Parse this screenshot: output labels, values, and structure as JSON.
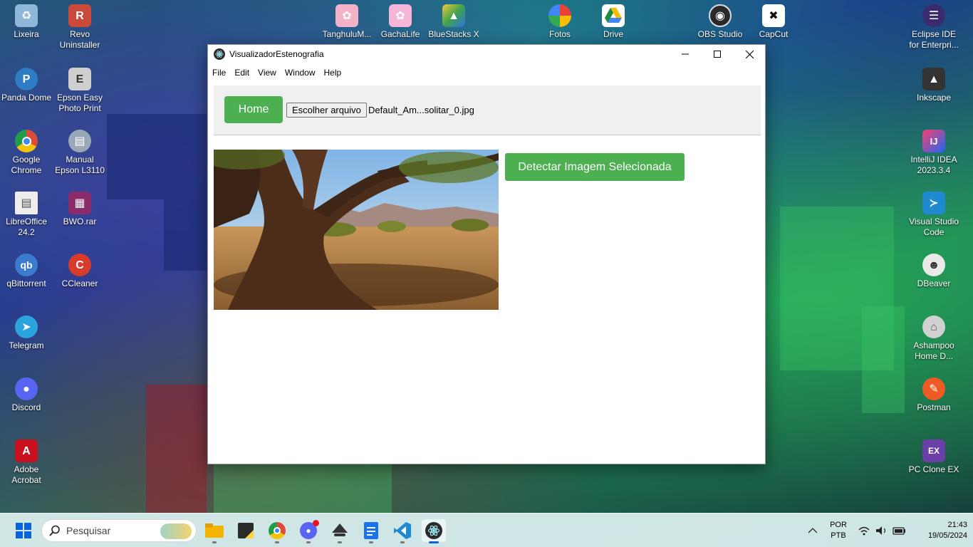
{
  "desktop": {
    "icons_left": [
      {
        "label": "Lixeira",
        "icon": "recycle-bin-icon",
        "color": "#8fb7d9"
      },
      {
        "label": "Revo Uninstaller",
        "icon": "revo-uninstaller-icon",
        "color": "#c94a3a"
      },
      {
        "label": "Panda Dome",
        "icon": "panda-dome-icon",
        "color": "#2e7cc4"
      },
      {
        "label": "Epson Easy Photo Print",
        "icon": "epson-photo-icon",
        "color": "#cfcfcf"
      },
      {
        "label": "Google Chrome",
        "icon": "chrome-icon",
        "color": "#dd4b39"
      },
      {
        "label": "Manual Epson L3110",
        "icon": "manual-icon",
        "color": "#9aa7b6"
      },
      {
        "label": "LibreOffice 24.2",
        "icon": "libreoffice-icon",
        "color": "#eeeeee"
      },
      {
        "label": "BWO.rar",
        "icon": "winrar-icon",
        "color": "#8a2b6a"
      },
      {
        "label": "qBittorrent",
        "icon": "qbittorrent-icon",
        "color": "#3b7cd1"
      },
      {
        "label": "CCleaner",
        "icon": "ccleaner-icon",
        "color": "#d83a2b"
      },
      {
        "label": "Telegram",
        "icon": "telegram-icon",
        "color": "#2aa3df"
      },
      {
        "label": "Discord",
        "icon": "discord-icon",
        "color": "#5865f2"
      },
      {
        "label": "Adobe Acrobat",
        "icon": "acrobat-icon",
        "color": "#c8101e"
      }
    ],
    "icons_top": [
      {
        "label": "TanghuluM...",
        "icon": "tanghulu-icon",
        "color": "#f3b2c8"
      },
      {
        "label": "GachaLife",
        "icon": "gachalife-icon",
        "color": "#f5b6d8"
      },
      {
        "label": "BlueStacks X",
        "icon": "bluestacks-icon",
        "color": "#3fa34d"
      },
      {
        "label": "Fotos",
        "icon": "photos-icon",
        "color": "#ffffff"
      },
      {
        "label": "Drive",
        "icon": "google-drive-icon",
        "color": "#ffffff"
      },
      {
        "label": "OBS Studio",
        "icon": "obs-icon",
        "color": "#2a2a2a"
      },
      {
        "label": "CapCut",
        "icon": "capcut-icon",
        "color": "#111111"
      }
    ],
    "icons_right": [
      {
        "label": "Eclipse IDE for Enterpri...",
        "icon": "eclipse-icon",
        "color": "#3a2a6e"
      },
      {
        "label": "Inkscape",
        "icon": "inkscape-icon",
        "color": "#333333"
      },
      {
        "label": "IntelliJ IDEA 2023.3.4",
        "icon": "intellij-icon",
        "color": "#1e66f5"
      },
      {
        "label": "Visual Studio Code",
        "icon": "vscode-icon",
        "color": "#1f8ad2"
      },
      {
        "label": "DBeaver",
        "icon": "dbeaver-icon",
        "color": "#e9e9e9"
      },
      {
        "label": "Ashampoo Home D...",
        "icon": "ashampoo-icon",
        "color": "#d0d0d0"
      },
      {
        "label": "Postman",
        "icon": "postman-icon",
        "color": "#ef5b25"
      },
      {
        "label": "PC Clone EX",
        "icon": "pc-clone-icon",
        "color": "#6a3fa8"
      }
    ]
  },
  "window": {
    "title": "VisualizadorEstenografia",
    "menu": [
      "File",
      "Edit",
      "View",
      "Window",
      "Help"
    ],
    "home_label": "Home",
    "file_button_label": "Escolher arquivo",
    "file_name": "Default_Am...solitar_0.jpg",
    "detect_label": "Detectar Imagem Selecionada",
    "accent": "#4caf50"
  },
  "taskbar": {
    "search_placeholder": "Pesquisar",
    "language_top": "POR",
    "language_bottom": "PTB",
    "time": "21:43",
    "date": "19/05/2024"
  }
}
